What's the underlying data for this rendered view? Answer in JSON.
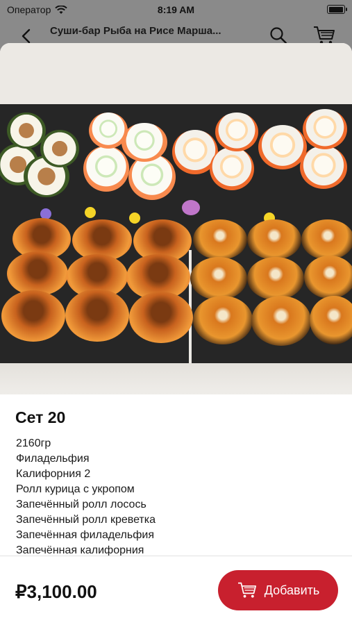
{
  "status_bar": {
    "carrier": "Оператор",
    "time": "8:19 AM",
    "icons": [
      "wifi-icon",
      "battery-icon"
    ],
    "battery_level": 1.0
  },
  "navbar": {
    "title": "Суши-бар Рыба на Рисе Марша...",
    "icons": [
      "back-icon",
      "search-icon",
      "cart-icon"
    ]
  },
  "product": {
    "title": "Сет 20",
    "description": [
      "2160гр",
      "Филадельфия",
      "Калифорния 2",
      "Ролл курица с укропом",
      "Запечённый ролл лосось",
      "Запечённый ролл креветка",
      "Запечённая филадельфия",
      "Запечённая калифорния"
    ],
    "price": "₽3,100.00"
  },
  "actions": {
    "add_label": "Добавить",
    "add_icon": "cart-icon"
  },
  "colors": {
    "accent": "#c8202e",
    "dim_overlay": "#8a8a8a"
  }
}
